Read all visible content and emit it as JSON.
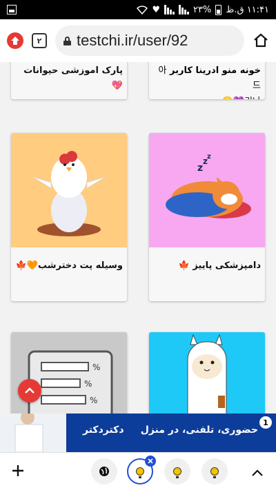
{
  "status_bar": {
    "time": "۱۱:۴۱ ق.ظ",
    "battery_percent": "۲۳%"
  },
  "browser": {
    "tab_count": "۲",
    "url": "testchi.ir/user/92"
  },
  "cards": [
    {
      "title": "خونه منو ادرینا کاربر",
      "title_prefix": "아드",
      "subtitle": "리나💜🙂"
    },
    {
      "title": "پارک اموزشی حیوانات 💖"
    },
    {
      "title": "دامپزشکی پاییز 🍁",
      "image": "sleeping-shiba-dog"
    },
    {
      "title": "وسیله پت دخترشب🧡🍁",
      "image": "chicken-on-egg"
    },
    {
      "title": "",
      "image": "survey-percent-chart"
    },
    {
      "title": "",
      "image": "cute-alpaca"
    }
  ],
  "ad": {
    "text": "حضوری، تلفنی، در منزل",
    "brand": "دکتردکتر",
    "badge": "1"
  },
  "colors": {
    "accent_red": "#e53935",
    "ad_blue": "#0d3d9a",
    "chicken_bg": "#ffcc80",
    "dog_bg": "#f7a8f0",
    "alpaca_bg": "#1ec9f7",
    "chart_bg": "#c9c9c9"
  }
}
